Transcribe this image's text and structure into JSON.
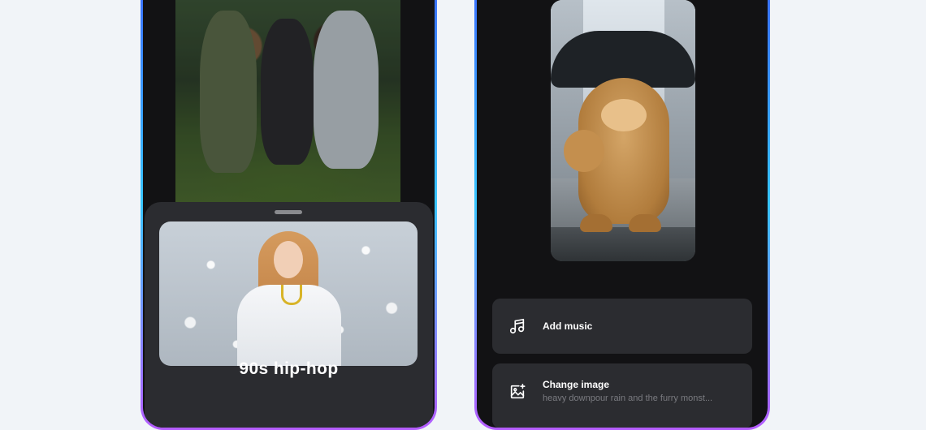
{
  "left_phone": {
    "style_title": "90s hip-hop"
  },
  "right_phone": {
    "options": [
      {
        "icon": "music-note-icon",
        "title": "Add music"
      },
      {
        "icon": "image-sparkle-icon",
        "title": "Change image",
        "subtitle": "heavy downpour rain and the furry monst..."
      }
    ]
  },
  "colors": {
    "background": "#f1f4f8",
    "phone_screen": "#121214",
    "card": "#2b2c30",
    "border_gradient_start": "#3b6bff",
    "border_gradient_mid": "#38c6ff",
    "border_gradient_end": "#b55cff"
  }
}
